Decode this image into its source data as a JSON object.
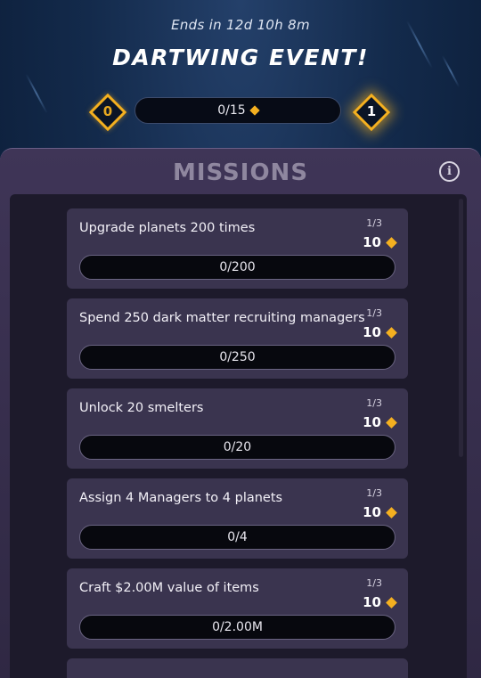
{
  "header": {
    "timer": "Ends in 12d 10h 8m",
    "title": "DARTWING  EVENT!",
    "tier_current": "0",
    "tier_next": "1",
    "progress_text": "0/15",
    "progress_fraction": 0,
    "accent_color": "#f4b020"
  },
  "missions": {
    "title": "MISSIONS",
    "info_icon": "info-icon",
    "items": [
      {
        "description": "Upgrade planets 200 times",
        "step": "1/3",
        "reward": "10",
        "progress": "0/200"
      },
      {
        "description": "Spend 250 dark matter recruiting managers",
        "step": "1/3",
        "reward": "10",
        "progress": "0/250"
      },
      {
        "description": "Unlock 20 smelters",
        "step": "1/3",
        "reward": "10",
        "progress": "0/20"
      },
      {
        "description": "Assign 4 Managers to 4 planets",
        "step": "1/3",
        "reward": "10",
        "progress": "0/4"
      },
      {
        "description": "Craft $2.00M  value of items",
        "step": "1/3",
        "reward": "10",
        "progress": "0/2.00M"
      }
    ]
  }
}
